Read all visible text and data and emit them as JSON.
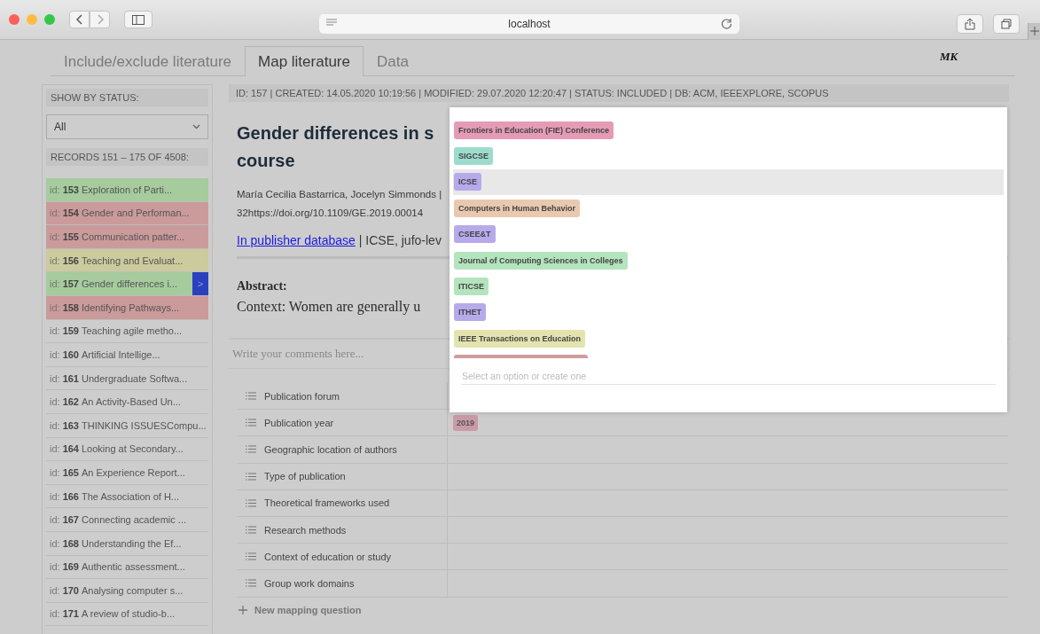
{
  "browser": {
    "url": "localhost"
  },
  "tabs": [
    {
      "label": "Include/exclude literature",
      "selected": false
    },
    {
      "label": "Map literature",
      "selected": true
    },
    {
      "label": "Data",
      "selected": false
    }
  ],
  "user_initials": "MK",
  "sidebar": {
    "status_heading": "SHOW BY STATUS:",
    "status_filter": "All",
    "records_heading": "RECORDS 151 – 175 OF 4508:",
    "records": [
      {
        "prefix": "id:",
        "id": "153",
        "title": "Exploration of Parti...",
        "color": "#a6cb9d",
        "selected": false
      },
      {
        "prefix": "id:",
        "id": "154",
        "title": "Gender and Performan...",
        "color": "#cb9a9b",
        "selected": false
      },
      {
        "prefix": "id:",
        "id": "155",
        "title": "Communication patter...",
        "color": "#cb9a9b",
        "selected": false
      },
      {
        "prefix": "id:",
        "id": "156",
        "title": "Teaching and Evaluat...",
        "color": "#cbcb9d",
        "selected": false
      },
      {
        "prefix": "id:",
        "id": "157",
        "title": "Gender differences i...",
        "color": "#a6cb9d",
        "selected": true,
        "open_label": ">"
      },
      {
        "prefix": "id:",
        "id": "158",
        "title": "Identifying Pathways...",
        "color": "#cb9a9b",
        "selected": false
      },
      {
        "prefix": "id:",
        "id": "159",
        "title": "Teaching agile metho...",
        "selected": false
      },
      {
        "prefix": "id:",
        "id": "160",
        "title": "Artificial Intellige...",
        "selected": false
      },
      {
        "prefix": "id:",
        "id": "161",
        "title": "Undergraduate Softwa...",
        "selected": false
      },
      {
        "prefix": "id:",
        "id": "162",
        "title": "An Activity-Based Un...",
        "selected": false
      },
      {
        "prefix": "id:",
        "id": "163",
        "title": "THINKING ISSUESCompu...",
        "selected": false
      },
      {
        "prefix": "id:",
        "id": "164",
        "title": "Looking at Secondary...",
        "selected": false
      },
      {
        "prefix": "id:",
        "id": "165",
        "title": "An Experience Report...",
        "selected": false
      },
      {
        "prefix": "id:",
        "id": "166",
        "title": "The Association of H...",
        "selected": false
      },
      {
        "prefix": "id:",
        "id": "167",
        "title": "Connecting academic ...",
        "selected": false
      },
      {
        "prefix": "id:",
        "id": "168",
        "title": "Understanding the Ef...",
        "selected": false
      },
      {
        "prefix": "id:",
        "id": "169",
        "title": "Authentic assessment...",
        "selected": false
      },
      {
        "prefix": "id:",
        "id": "170",
        "title": "Analysing computer s...",
        "selected": false
      },
      {
        "prefix": "id:",
        "id": "171",
        "title": "A review of studio-b...",
        "selected": false
      }
    ]
  },
  "record": {
    "meta": "ID: 157 | CREATED: 14.05.2020 10:19:56 | MODIFIED: 29.07.2020 12:20:47 | STATUS: INCLUDED | DB: ACM, IEEEXPLORE, SCOPUS",
    "title_lines": [
      "Gender differences in s",
      "course"
    ],
    "detail_lines": [
      "María Cecilia Bastarrica, Jocelyn Simmonds |",
      "32https://doi.org/10.1109/GE.2019.00014"
    ],
    "link": "In publisher database",
    "link_rest": " | ICSE, jufo-lev",
    "abstract_heading": "Abstract:",
    "abstract_text": "Context: Women are generally u",
    "comments_placeholder": "Write your comments here..."
  },
  "mapping_questions": [
    {
      "label": "Publication forum"
    },
    {
      "label": "Publication year",
      "values": [
        {
          "label": "2019",
          "color": "#c99aa8"
        }
      ]
    },
    {
      "label": "Geographic location of authors"
    },
    {
      "label": "Type of publication"
    },
    {
      "label": "Theoretical frameworks used"
    },
    {
      "label": "Research methods"
    },
    {
      "label": "Context of education or study"
    },
    {
      "label": "Group work domains"
    }
  ],
  "new_question": "New mapping question",
  "popup": {
    "options": [
      {
        "label": "Frontiers in Education (FIE) Conference",
        "color": "#e59bb5",
        "selected": false
      },
      {
        "label": "SIGCSE",
        "color": "#9ddccd",
        "selected": false
      },
      {
        "label": "ICSE",
        "color": "#b6aaea",
        "selected": true
      },
      {
        "label": "Computers in Human Behavior",
        "color": "#e8c9b0",
        "selected": false
      },
      {
        "label": "CSEE&T",
        "color": "#b6aaea",
        "selected": false
      },
      {
        "label": "Journal of Computing Sciences in Colleges",
        "color": "#b4e4bd",
        "selected": false
      },
      {
        "label": "ITICSE",
        "color": "#b4e4bd",
        "selected": false
      },
      {
        "label": "ITHET",
        "color": "#b6aaea",
        "selected": false
      },
      {
        "label": "IEEE Transactions on Education",
        "color": "#e3e3b0",
        "selected": false
      },
      {
        "color": "#cf9d9d",
        "selected": false
      }
    ],
    "placeholder": "Select an option or create one"
  }
}
